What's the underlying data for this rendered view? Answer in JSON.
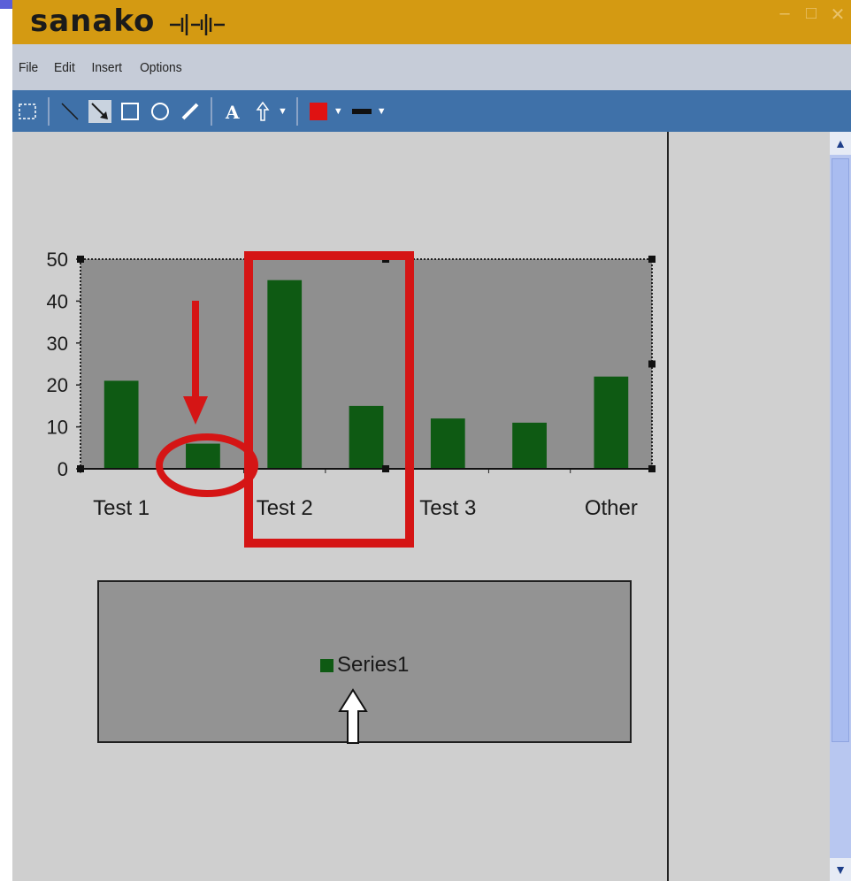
{
  "app": {
    "brand": "sanako"
  },
  "window_controls": [
    "–",
    "□",
    "✕"
  ],
  "menu": [
    "File",
    "Edit",
    "Insert",
    "Options"
  ],
  "toolbar": {
    "tools": [
      "select-rect-icon",
      "line-icon",
      "arrow-icon",
      "rectangle-icon",
      "ellipse-icon",
      "pen-icon",
      "text-icon",
      "pointer-icon",
      "fill-color-icon",
      "line-style-icon"
    ],
    "fill_color": "#e01212"
  },
  "chart_data": {
    "type": "bar",
    "categories": [
      "Test 1",
      "",
      "Test 2",
      "",
      "Test 3",
      "",
      "Other"
    ],
    "series": [
      {
        "name": "Series1",
        "values": [
          21,
          6,
          45,
          15,
          12,
          11,
          22
        ],
        "color": "#0e5a13"
      }
    ],
    "ylim": [
      0,
      50
    ],
    "yticks": [
      0,
      10,
      20,
      30,
      40,
      50
    ],
    "legend": "bottom",
    "plot_background": "#8f8f8f"
  },
  "annotation_color": "#d51515"
}
